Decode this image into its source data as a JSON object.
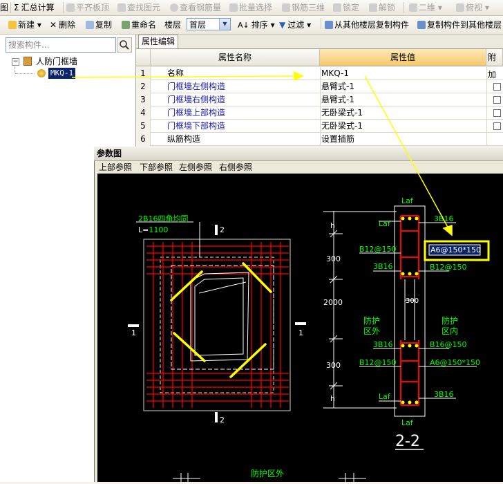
{
  "toolbar1": {
    "partial_label": "图",
    "sum_label": "汇总计算",
    "level_label": "平齐板顶",
    "find_label": "查找图元",
    "view_rebar_label": "查看钢筋量",
    "batch_select_label": "批量选择",
    "rebar3d_label": "钢筋三维",
    "lock_label": "锁定",
    "unlock_label": "解锁",
    "view_mode": "二维",
    "top_view_label": "俯视"
  },
  "toolbar2": {
    "new_label": "新建",
    "delete_label": "删除",
    "copy_label": "复制",
    "rename_label": "重命名",
    "floor_label": "楼层",
    "floor_value": "首层",
    "sort_label": "排序",
    "filter_label": "过滤",
    "copy_from_floor_label": "从其他楼层复制构件",
    "copy_to_floor_label": "复制构件到其他楼层"
  },
  "tree": {
    "search_placeholder": "搜索构件...",
    "root_label": "人防门框墙",
    "child_label": "MKQ-1"
  },
  "properties": {
    "tab_label": "属性编辑",
    "col_name": "属性名称",
    "col_value": "属性值",
    "col_extra": "附加",
    "rows": [
      {
        "no": "1",
        "name": "名称",
        "value": "MKQ-1",
        "has_check": false
      },
      {
        "no": "2",
        "name": "门框墙左侧构造",
        "value": "悬臂式-1",
        "has_check": true
      },
      {
        "no": "3",
        "name": "门框墙右侧构造",
        "value": "悬臂式-1",
        "has_check": true
      },
      {
        "no": "4",
        "name": "门框墙上部构造",
        "value": "无卧梁式-1",
        "has_check": true
      },
      {
        "no": "5",
        "name": "门框墙下部构造",
        "value": "无卧梁式-1",
        "has_check": true
      },
      {
        "no": "6",
        "name": "纵筋构造",
        "value": "设置插筋",
        "has_check": false
      }
    ]
  },
  "dialog": {
    "title": "参数图",
    "menu": [
      "上部参照",
      "下部参照",
      "左侧参照",
      "右侧参照"
    ]
  },
  "drawing": {
    "corner_note": "2B16四角均同",
    "l_label": "L=",
    "l_value": "1100",
    "cut_mark": "2",
    "side_mark": "1",
    "dim_h": "h",
    "dim_300a": "300",
    "dim_2000": "2000",
    "dim_300b": "300",
    "laf": "Laf",
    "b12_150": "B12@150",
    "b3_16": "3B16",
    "a6_highlight": "A6@150*150",
    "b12_150_r": "B12@150",
    "mid_300": "300",
    "outside_1": "防护",
    "outside_2": "区外",
    "inside_1": "防护",
    "inside_2": "区内",
    "b16_150": "B16@150",
    "a6_150": "A6@150*150",
    "section_label": "2-2",
    "bottom_outside": "防护区外"
  },
  "colors": {
    "rebar_red": "#ff0000",
    "diag_yellow": "#ffff00",
    "label_green": "#00ff00",
    "title_blue": "#000080",
    "highlight": "#0a246a"
  }
}
